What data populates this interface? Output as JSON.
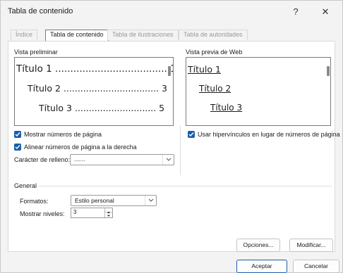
{
  "window": {
    "title": "Tabla de contenido",
    "help_glyph": "?",
    "close_glyph": "✕"
  },
  "tabs": [
    {
      "label": "Índice"
    },
    {
      "label": "Tabla de contenido"
    },
    {
      "label": "Tabla de ilustraciones"
    },
    {
      "label": "Tabla de autoridades"
    }
  ],
  "print_preview": {
    "label": "Vista preliminar",
    "lines": [
      "Título 1 ..................................... 1",
      "Título 2 .................................. 3",
      "Título 3 ............................. 5"
    ]
  },
  "web_preview": {
    "label": "Vista previa de Web",
    "lines": [
      "Título 1",
      "Título 2",
      "Título 3"
    ]
  },
  "options": {
    "show_page_numbers": "Mostrar números de página",
    "align_right": "Alinear números de página a la derecha",
    "leader_label": "Carácter de relleno:",
    "leader_value": ".......",
    "use_hyperlinks": "Usar hipervínculos en lugar de números de página"
  },
  "general": {
    "heading": "General",
    "formats_label": "Formatos:",
    "formats_value": "Estilo personal",
    "levels_label": "Mostrar niveles:",
    "levels_value": "3"
  },
  "buttons": {
    "options": "Opciones...",
    "modify": "Modificar...",
    "ok": "Aceptar",
    "cancel": "Cancelar"
  },
  "colors": {
    "checkbox": "#1a5ea8",
    "dialog_bg": "#f3f3f3"
  }
}
